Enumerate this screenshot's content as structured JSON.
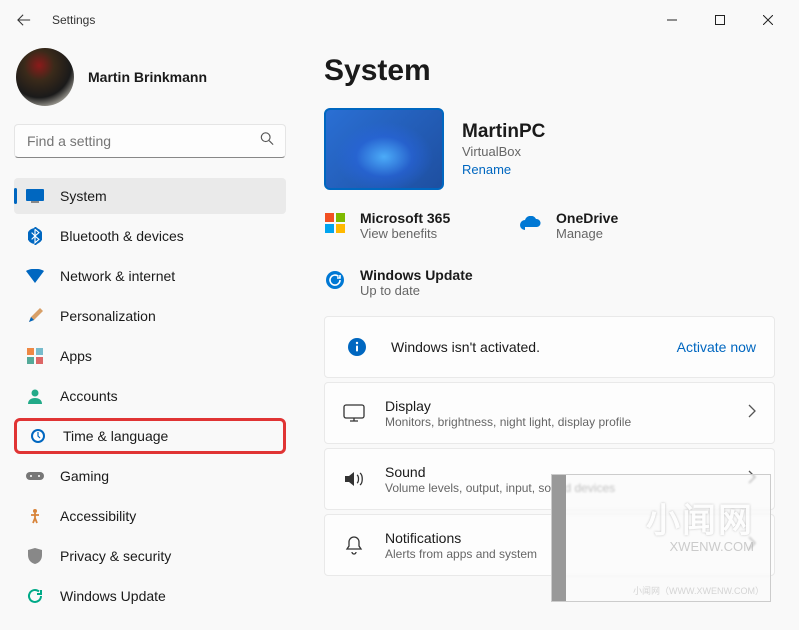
{
  "titlebar": {
    "title": "Settings"
  },
  "profile": {
    "name": "Martin Brinkmann"
  },
  "search": {
    "placeholder": "Find a setting"
  },
  "sidebar": {
    "items": [
      {
        "label": "System"
      },
      {
        "label": "Bluetooth & devices"
      },
      {
        "label": "Network & internet"
      },
      {
        "label": "Personalization"
      },
      {
        "label": "Apps"
      },
      {
        "label": "Accounts"
      },
      {
        "label": "Time & language"
      },
      {
        "label": "Gaming"
      },
      {
        "label": "Accessibility"
      },
      {
        "label": "Privacy & security"
      },
      {
        "label": "Windows Update"
      }
    ]
  },
  "page": {
    "title": "System",
    "device": {
      "name": "MartinPC",
      "sub": "VirtualBox",
      "rename": "Rename"
    },
    "services": [
      {
        "title": "Microsoft 365",
        "sub": "View benefits"
      },
      {
        "title": "OneDrive",
        "sub": "Manage"
      },
      {
        "title": "Windows Update",
        "sub": "Up to date"
      }
    ],
    "activation": {
      "text": "Windows isn't activated.",
      "action": "Activate now"
    },
    "cards": [
      {
        "title": "Display",
        "sub": "Monitors, brightness, night light, display profile"
      },
      {
        "title": "Sound",
        "sub": "Volume levels, output, input, sound devices"
      },
      {
        "title": "Notifications",
        "sub": "Alerts from apps and system"
      }
    ]
  },
  "watermark": {
    "big": "小闻网",
    "sub": "XWENW.COM",
    "foot": "小闻网（WWW.XWENW.COM）"
  },
  "colors": {
    "accent": "#0067c0",
    "highlight": "#e03434"
  }
}
